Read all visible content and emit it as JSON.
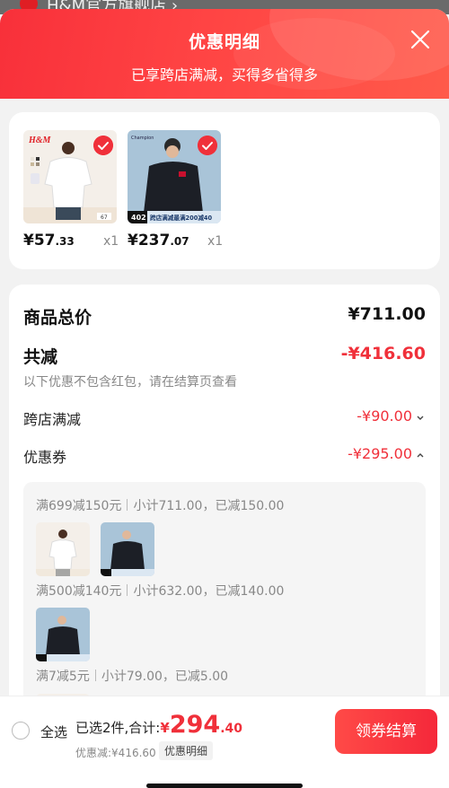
{
  "background_store": {
    "title": "H&M官方旗舰店 ›"
  },
  "header": {
    "title": "优惠明细",
    "subtitle": "已享跨店满减，买得多省得多"
  },
  "products": [
    {
      "brand": "H&M",
      "price_int": "¥57",
      "price_dec": ".33",
      "qty": "x1"
    },
    {
      "brand": "Champion",
      "badge": "402",
      "promo": "跨店满减最满200减40",
      "price_int": "¥237",
      "price_dec": ".07",
      "qty": "x1"
    }
  ],
  "summary_rows": {
    "total_label": "商品总价",
    "total_value": "¥711.00",
    "discount_label": "共减",
    "discount_value": "-¥416.60",
    "note": "以下优惠不包含红包，请在结算页查看",
    "cross_store_label": "跨店满减",
    "cross_store_value": "-¥90.00",
    "coupon_label": "优惠券",
    "coupon_value": "-¥295.00"
  },
  "coupon_groups": [
    {
      "rule": "满699减150元",
      "detail": "小计711.00，已减150.00"
    },
    {
      "rule": "满500减140元",
      "detail": "小计632.00，已减140.00"
    },
    {
      "rule": "满7减5元",
      "detail": "小计79.00，已减5.00"
    }
  ],
  "bottom_bar": {
    "select_all": "全选",
    "selected_text": "已选2件,合计:",
    "currency": "¥",
    "total_int": "294",
    "total_dec": ".40",
    "saved_text": "优惠减:¥416.60",
    "detail_link": "优惠明细",
    "checkout_label": "领券结算"
  },
  "colors": {
    "accent": "#f0303a",
    "header_start": "#f8303a",
    "header_end": "#ff5a4a"
  },
  "icons": {
    "close": "close-icon",
    "check": "check-icon",
    "chevron_down": "chevron-down-icon",
    "chevron_up": "chevron-up-icon"
  }
}
